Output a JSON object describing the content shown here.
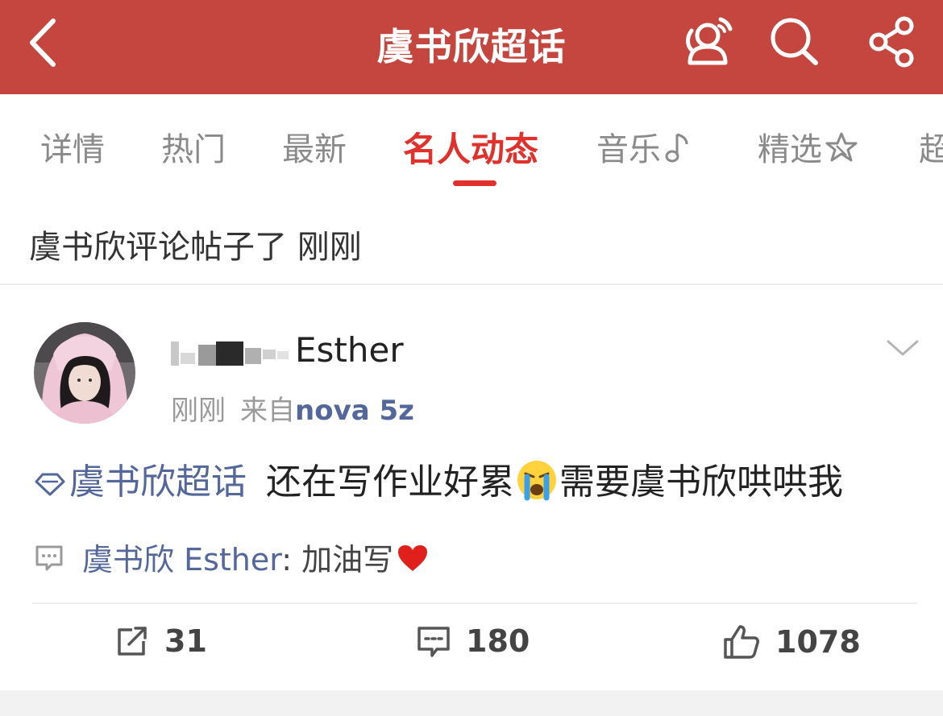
{
  "header": {
    "title": "虞书欣超话",
    "bg_color": "#c5463f",
    "icons": [
      "back-icon",
      "people-icon",
      "search-icon",
      "share-icon"
    ]
  },
  "tabs": [
    {
      "label": "详情",
      "active": false
    },
    {
      "label": "热门",
      "active": false
    },
    {
      "label": "最新",
      "active": false
    },
    {
      "label": "名人动态",
      "active": true
    },
    {
      "label": "音乐",
      "active": false,
      "icon": "music-note-icon"
    },
    {
      "label": "精选",
      "active": false,
      "icon": "star-icon"
    },
    {
      "label": "超",
      "active": false
    }
  ],
  "active_color": "#e0312d",
  "topic_row": {
    "text": "虞书欣评论帖子了 刚刚"
  },
  "post": {
    "username_suffix": "Esther",
    "time": "刚刚",
    "from_label": "来自",
    "device": "nova 5z",
    "topic": "虞书欣超话",
    "body_1": "还在写作业好累",
    "body_2": "需要虞书欣哄哄我",
    "comment": {
      "author": "虞书欣 Esther",
      "separator": ": ",
      "text": "加油写"
    },
    "actions": {
      "reposts": "31",
      "comments": "180",
      "likes": "1078"
    }
  },
  "link_color": "#53679a"
}
